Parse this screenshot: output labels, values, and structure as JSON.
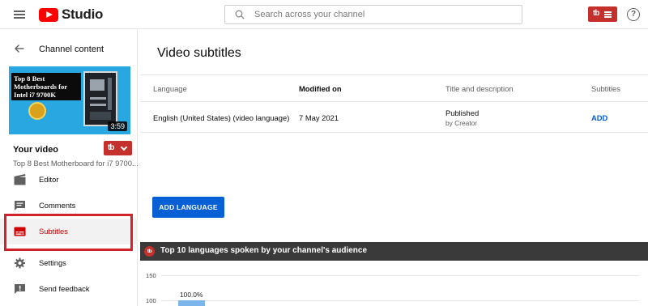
{
  "app": {
    "logo_text": "Studio"
  },
  "header": {
    "search_placeholder": "Search across your channel",
    "extension_label": "tb",
    "help_symbol": "?"
  },
  "sidebar": {
    "back_label": "Channel content",
    "thumbnail": {
      "title_text": "Top 8 Best Motherboards for Intel i7 9700K",
      "seal_text": "Best Seller",
      "duration": "3:59"
    },
    "your_video_label": "Your video",
    "video_title": "Top 8 Best Motherboard for i7 9700...",
    "extension_label": "tb",
    "items": [
      {
        "label": "Editor",
        "icon": "editor-clapper-icon",
        "active": false
      },
      {
        "label": "Comments",
        "icon": "comments-icon",
        "active": false
      },
      {
        "label": "Subtitles",
        "icon": "subtitles-icon",
        "active": true
      },
      {
        "label": "Settings",
        "icon": "gear-icon",
        "active": false
      },
      {
        "label": "Send feedback",
        "icon": "feedback-icon",
        "active": false
      }
    ]
  },
  "main": {
    "title": "Video subtitles",
    "table": {
      "headers": [
        "Language",
        "Modified on",
        "Title and description",
        "Subtitles"
      ],
      "rows": [
        {
          "language": "English (United States) (video language)",
          "modified_on": "7 May 2021",
          "status": "Published",
          "status_by": "by Creator",
          "action": "ADD"
        }
      ]
    },
    "add_language_label": "ADD LANGUAGE"
  },
  "languages_panel": {
    "logo_text": "tb",
    "title": "Top 10 languages spoken by your channel's audience",
    "y_ticks": [
      "150",
      "100"
    ],
    "bar_label": "100.0%",
    "bar_value_percent": 100.0
  },
  "colors": {
    "accent_blue": "#065fd4",
    "brand_red": "#ff0000",
    "extension_red": "#c4302b",
    "highlight_red": "#d2232a",
    "bar_blue": "#7cb5ec"
  }
}
